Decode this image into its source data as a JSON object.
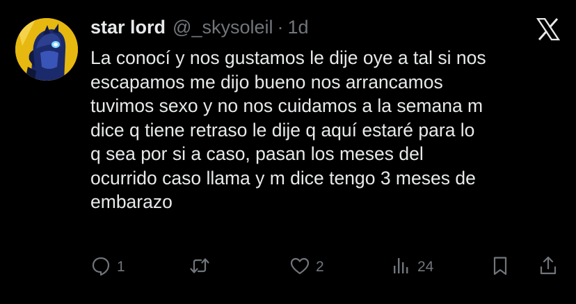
{
  "tweet": {
    "display_name": "star lord",
    "handle": "@_skysoleil",
    "separator": "·",
    "time": "1d",
    "text": "La conocí y nos gustamos le dije oye a tal si nos\nescapamos me dijo bueno nos arrancamos\ntuvimos sexo y no nos cuidamos a la semana m\ndice q tiene retraso le dije q aquí estaré para lo\nq sea por si a caso, pasan los meses del\nocurrido caso llama y m dice tengo 3 meses de\nembarazo"
  },
  "actions": {
    "replies": "1",
    "reposts": "",
    "likes": "2",
    "views": "24"
  },
  "icons": {
    "reply": "comment-icon",
    "repost": "repost-icon",
    "like": "heart-icon",
    "views": "analytics-icon",
    "bookmark": "bookmark-icon",
    "share": "share-icon",
    "brand": "x-logo-icon"
  },
  "colors": {
    "background": "#000000",
    "text_primary": "#e7e9ea",
    "text_secondary": "#71767b",
    "avatar_bg": "#e7b80f"
  }
}
